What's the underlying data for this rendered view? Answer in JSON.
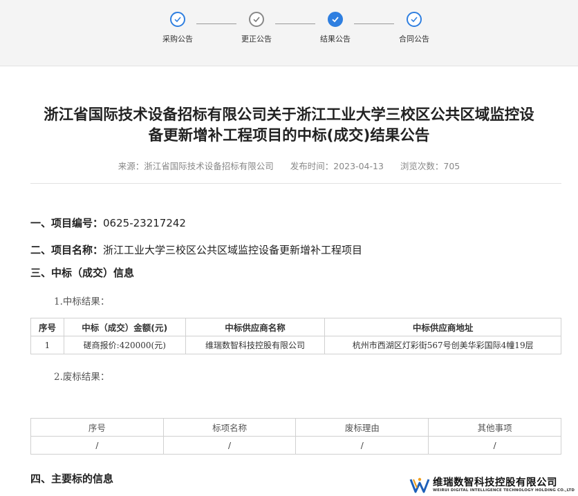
{
  "steps": [
    {
      "label": "采购公告",
      "state": "active"
    },
    {
      "label": "更正公告",
      "state": "done"
    },
    {
      "label": "结果公告",
      "state": "current"
    },
    {
      "label": "合同公告",
      "state": "active"
    }
  ],
  "article": {
    "title_line1": "浙江省国际技术设备招标有限公司关于浙江工业大学三校区公共区域监控设",
    "title_line2": "备更新增补工程项目的中标(成交)结果公告",
    "source": "来源：浙江省国际技术设备招标有限公司",
    "publish_time": "发布时间：2023-04-13",
    "views": "浏览次数：705"
  },
  "sections": {
    "s1_label": "一、项目编号：",
    "s1_value": "0625-23217242",
    "s2_label": "二、项目名称：",
    "s2_value": "浙江工业大学三校区公共区域监控设备更新增补工程项目",
    "s3_label": "三、中标（成交）信息",
    "sub1": "1.中标结果：",
    "sub2": "2.废标结果：",
    "s4_label": "四、主要标的信息"
  },
  "win_table": {
    "headers": [
      "序号",
      "中标（成交）金额(元)",
      "中标供应商名称",
      "中标供应商地址"
    ],
    "rows": [
      [
        "1",
        "磋商报价:420000(元)",
        "维瑞数智科技控股有限公司",
        "杭州市西湖区灯彩街567号创美华彩国际4幢19层"
      ]
    ]
  },
  "fail_table": {
    "headers": [
      "序号",
      "标项名称",
      "废标理由",
      "其他事项"
    ],
    "rows": [
      [
        "/",
        "/",
        "/",
        "/"
      ]
    ]
  },
  "logo": {
    "text_cn": "维瑞数智科技控股有限公司",
    "text_en": "WEIRUI DIGITAL INTELLIGENCE TECHNOLOGY HOLDING CO.,LTD"
  },
  "colors": {
    "accent": "#2f7fe0",
    "done": "#888888"
  }
}
